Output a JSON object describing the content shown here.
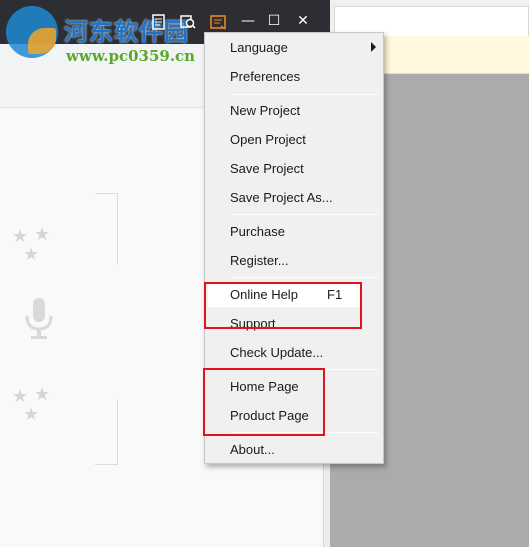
{
  "watermark": {
    "site_name": "河东软件园",
    "site_url": "www.pc0359.cn"
  },
  "toolbar": {
    "icons": [
      "document-icon",
      "search-icon",
      "menu-icon"
    ],
    "window_buttons": {
      "minimize": "—",
      "maximize": "☐",
      "close": "✕"
    }
  },
  "menu": {
    "items": [
      {
        "label": "Language",
        "has_submenu": true
      },
      {
        "label": "Preferences"
      },
      {
        "label": "New Project"
      },
      {
        "label": "Open Project"
      },
      {
        "label": "Save Project"
      },
      {
        "label": "Save Project As..."
      },
      {
        "label": "Purchase"
      },
      {
        "label": "Register..."
      },
      {
        "label": "Online Help",
        "shortcut": "F1",
        "highlighted": true
      },
      {
        "label": "Support"
      },
      {
        "label": "Check Update..."
      },
      {
        "label": "Home Page"
      },
      {
        "label": "Product Page"
      },
      {
        "label": "About..."
      }
    ]
  },
  "colors": {
    "annotation_box": "#e0141e",
    "titlebar": "#2c2e33",
    "menu_bg": "#f0f0f0"
  }
}
